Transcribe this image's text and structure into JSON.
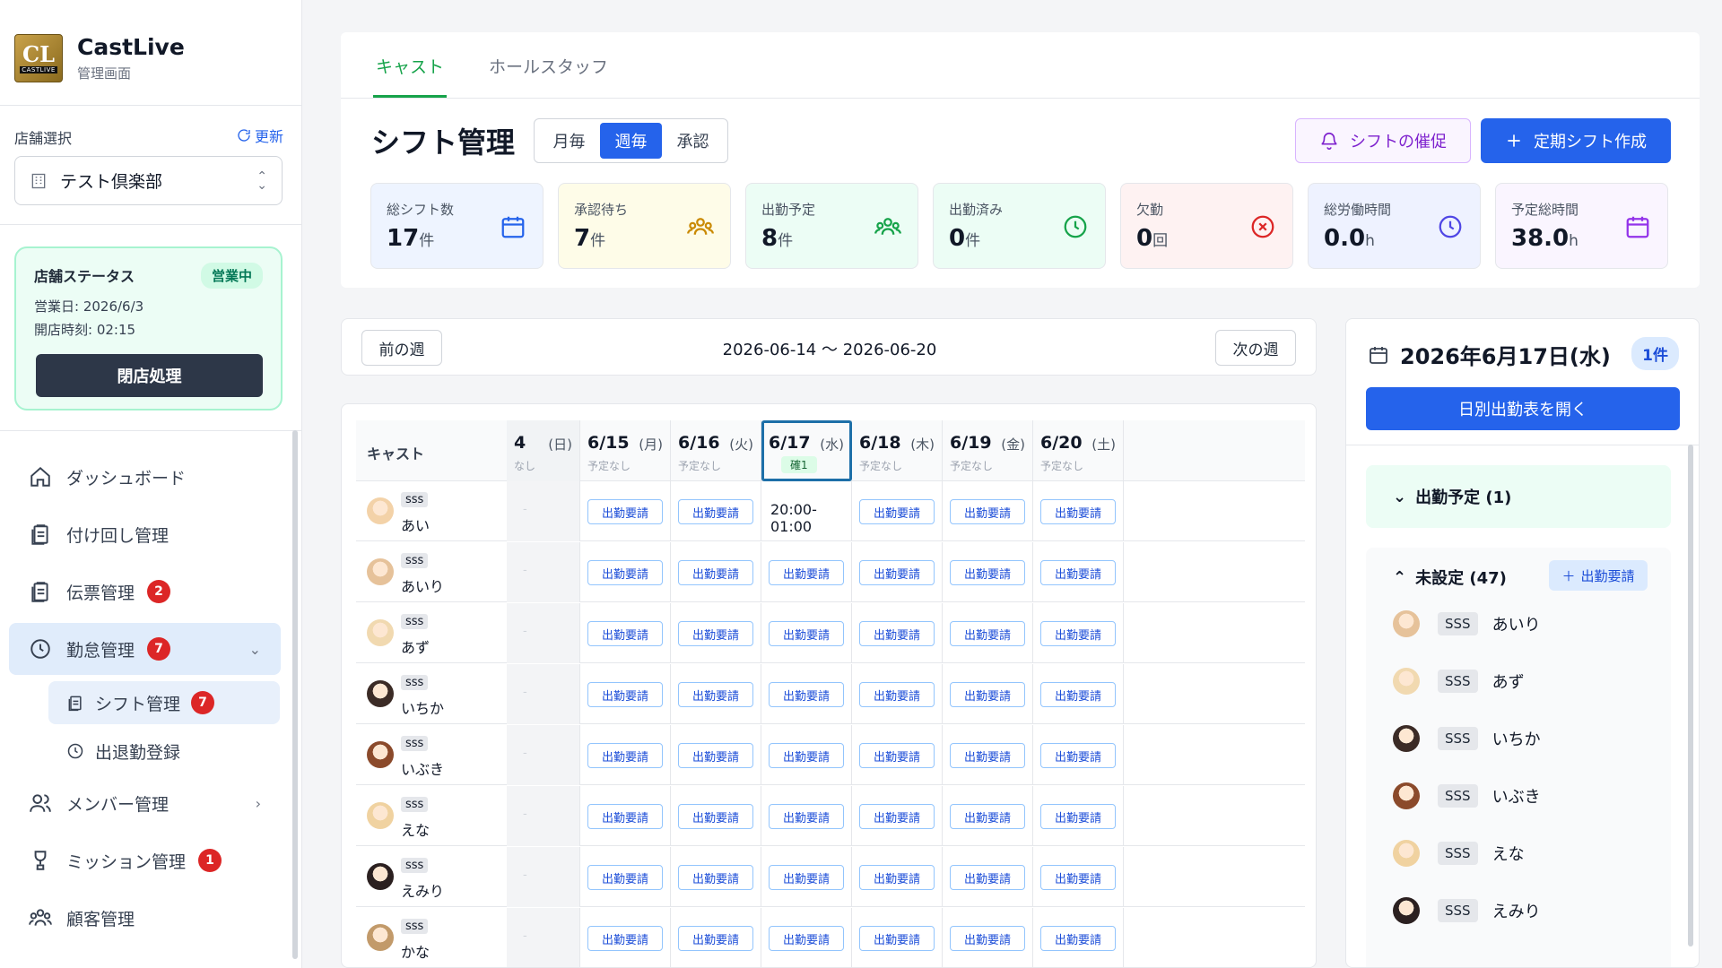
{
  "brand": {
    "name": "CastLive",
    "subtitle": "管理画面",
    "logo_mark": "CL",
    "logo_text": "CASTLIVE"
  },
  "store": {
    "label": "店舗選択",
    "refresh": "更新",
    "selected": "テスト倶楽部"
  },
  "status": {
    "title": "店舗ステータス",
    "badge": "営業中",
    "business_day": "営業日: 2026/6/3",
    "open_time": "開店時刻: 02:15",
    "close_button": "閉店処理"
  },
  "nav": {
    "dashboard": "ダッシュボード",
    "assign": "付け回し管理",
    "slip": "伝票管理",
    "slip_badge": "2",
    "attendance": "勤怠管理",
    "attendance_badge": "7",
    "shift": "シフト管理",
    "shift_badge": "7",
    "clock": "出退勤登録",
    "member": "メンバー管理",
    "mission": "ミッション管理",
    "mission_badge": "1",
    "customer": "顧客管理"
  },
  "tabs": [
    "キャスト",
    "ホールスタッフ"
  ],
  "page": {
    "title": "シフト管理",
    "segments": [
      "月毎",
      "週毎",
      "承認"
    ],
    "remind_button": "シフトの催促",
    "create_button": "定期シフト作成"
  },
  "stats": [
    {
      "label": "総シフト数",
      "value": "17",
      "unit": "件",
      "icon": "calendar-icon",
      "bg": "#eef4ff",
      "color": "#2563eb"
    },
    {
      "label": "承認待ち",
      "value": "7",
      "unit": "件",
      "icon": "users-icon",
      "bg": "#fefce8",
      "color": "#ca8a04"
    },
    {
      "label": "出勤予定",
      "value": "8",
      "unit": "件",
      "icon": "users-icon",
      "bg": "#ecfdf5",
      "color": "#16a34a"
    },
    {
      "label": "出勤済み",
      "value": "0",
      "unit": "件",
      "icon": "clock-icon",
      "bg": "#ecfdf5",
      "color": "#16a34a"
    },
    {
      "label": "欠勤",
      "value": "0",
      "unit": "回",
      "icon": "x-circle-icon",
      "bg": "#fef2f2",
      "color": "#dc2626"
    },
    {
      "label": "総労働時間",
      "value": "0.0",
      "unit": "h",
      "icon": "clock-icon",
      "bg": "#eef2ff",
      "color": "#4f46e5"
    },
    {
      "label": "予定総時間",
      "value": "38.0",
      "unit": "h",
      "icon": "calendar-icon",
      "bg": "#faf5ff",
      "color": "#9333ea"
    }
  ],
  "week": {
    "prev": "前の週",
    "next": "次の週",
    "range": "2026-06-14 〜 2026-06-20"
  },
  "grid": {
    "cast_header": "キャスト",
    "days": [
      {
        "date": "4",
        "weekday": "(日)",
        "sub": "なし"
      },
      {
        "date": "6/15",
        "weekday": "(月)",
        "sub": "予定なし"
      },
      {
        "date": "6/16",
        "weekday": "(火)",
        "sub": "予定なし"
      },
      {
        "date": "6/17",
        "weekday": "(水)",
        "sub": "確1"
      },
      {
        "date": "6/18",
        "weekday": "(木)",
        "sub": "予定なし"
      },
      {
        "date": "6/19",
        "weekday": "(金)",
        "sub": "予定なし"
      },
      {
        "date": "6/20",
        "weekday": "(土)",
        "sub": "予定なし"
      }
    ],
    "request_label": "出勤要請",
    "empty_mark": "-",
    "rows": [
      {
        "rank": "sss",
        "name": "あい",
        "shift_617": "20:00-01:00"
      },
      {
        "rank": "sss",
        "name": "あいり"
      },
      {
        "rank": "sss",
        "name": "あず"
      },
      {
        "rank": "sss",
        "name": "いちか"
      },
      {
        "rank": "sss",
        "name": "いぶき"
      },
      {
        "rank": "sss",
        "name": "えな"
      },
      {
        "rank": "sss",
        "name": "えみり"
      },
      {
        "rank": "sss",
        "name": "かな"
      }
    ]
  },
  "panel": {
    "date": "2026年6月17日(水)",
    "count": "1件",
    "open_button": "日別出勤表を開く",
    "scheduled": "出勤予定 (1)",
    "unset": "未設定 (47)",
    "add_request": "出勤要請",
    "items": [
      {
        "rank": "SSS",
        "name": "あいり"
      },
      {
        "rank": "SSS",
        "name": "あず"
      },
      {
        "rank": "SSS",
        "name": "いちか"
      },
      {
        "rank": "SSS",
        "name": "いぶき"
      },
      {
        "rank": "SSS",
        "name": "えな"
      },
      {
        "rank": "SSS",
        "name": "えみり"
      }
    ]
  }
}
